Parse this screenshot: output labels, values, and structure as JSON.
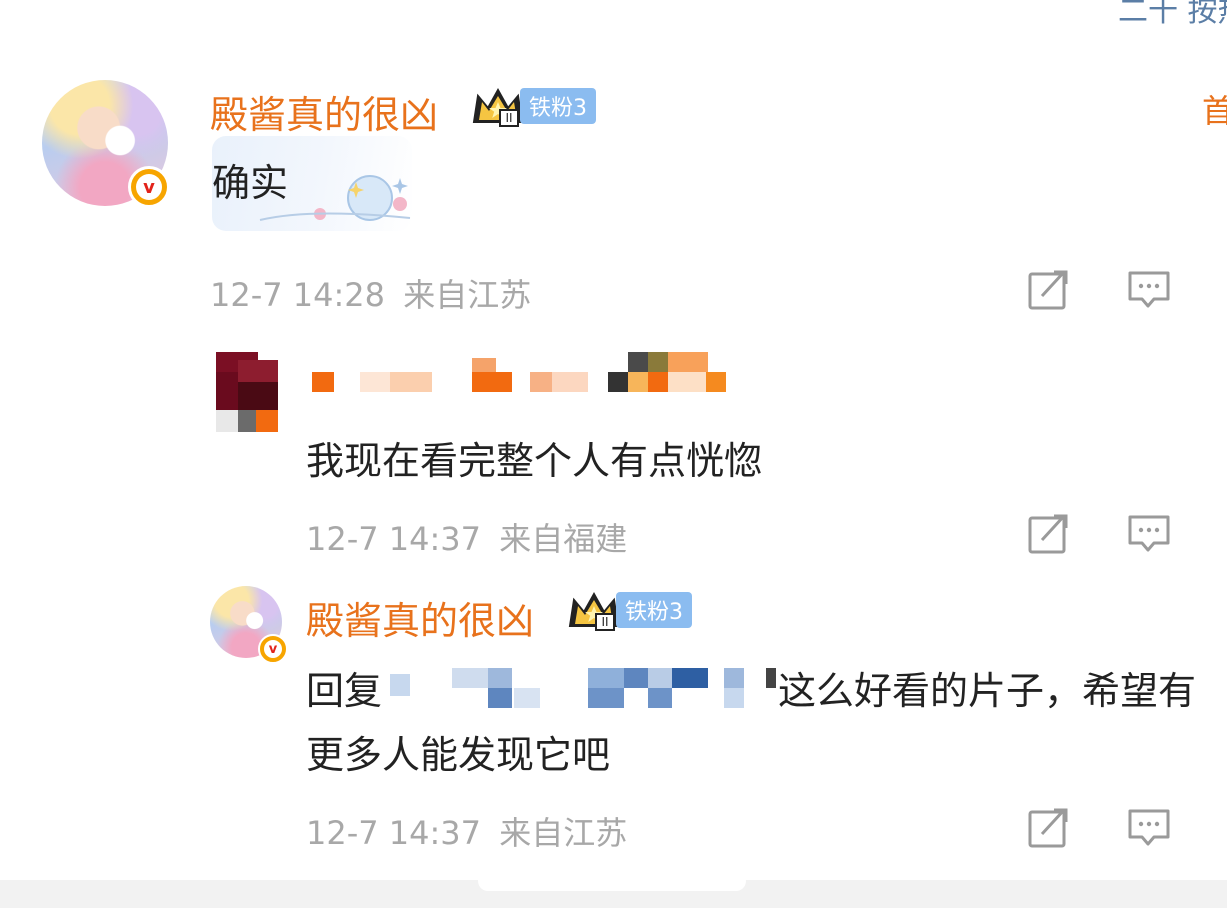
{
  "header": {
    "sort_label_partial": "二十 按热"
  },
  "colors": {
    "username": "#e8721c",
    "meta": "#a8a8a8",
    "fan_badge": "#8bbcf0",
    "verified": "#f7a500"
  },
  "comments": [
    {
      "username": "殿酱真的很凶",
      "fan_badge": "铁粉3",
      "text": "确实",
      "timestamp": "12-7 14:28",
      "location": "来自江苏",
      "side_label": "首",
      "verified": true,
      "has_pixelated_avatar": false
    },
    {
      "username": "",
      "text": "我现在看完整个人有点恍惚",
      "timestamp": "12-7 14:37",
      "location": "来自福建",
      "has_pixelated_avatar": true
    },
    {
      "username": "殿酱真的很凶",
      "fan_badge": "铁粉3",
      "text_prefix": "回复",
      "text_line1": "这么好看的片子，希望有",
      "text_line2": "更多人能发现它吧",
      "timestamp": "12-7 14:37",
      "location": "来自江苏",
      "verified": true
    }
  ],
  "icons": {
    "share": "share-icon",
    "reply": "comment-icon",
    "crown": "crown-icon",
    "verified": "verified-v-icon"
  }
}
